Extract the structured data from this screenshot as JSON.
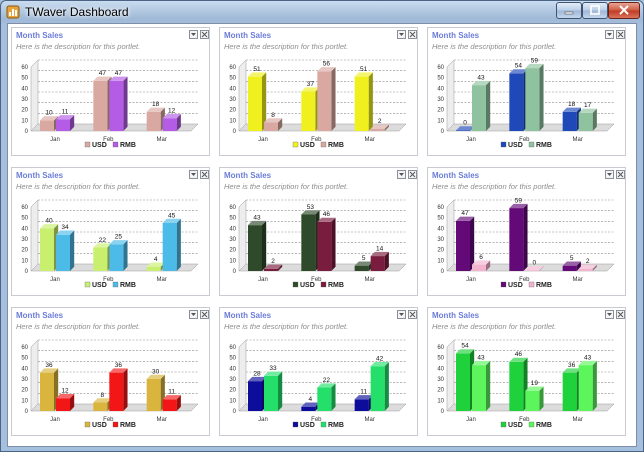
{
  "window": {
    "title": "TWaver Dashboard"
  },
  "portlets": [
    {
      "title": "Month Sales",
      "description": "Here is the description for this portlet.",
      "chart_data": {
        "type": "bar",
        "categories": [
          "Jan",
          "Feb",
          "Mar"
        ],
        "ylim": [
          0,
          60
        ],
        "yticks": [
          0,
          10,
          20,
          30,
          40,
          50,
          60
        ],
        "series": [
          {
            "name": "USD",
            "color": "#d9a9a1",
            "values": [
              10,
              47,
              18
            ]
          },
          {
            "name": "RMB",
            "color": "#b45ce6",
            "values": [
              11,
              47,
              12
            ]
          }
        ]
      }
    },
    {
      "title": "Month Sales",
      "description": "Here is the description for this portlet.",
      "chart_data": {
        "type": "bar",
        "categories": [
          "Jan",
          "Feb",
          "Mar"
        ],
        "ylim": [
          0,
          60
        ],
        "yticks": [
          0,
          10,
          20,
          30,
          40,
          50,
          60
        ],
        "series": [
          {
            "name": "USD",
            "color": "#f0f01e",
            "values": [
              51,
              37,
              51
            ]
          },
          {
            "name": "RMB",
            "color": "#d9a9a1",
            "values": [
              8,
              56,
              2
            ]
          }
        ]
      }
    },
    {
      "title": "Month Sales",
      "description": "Here is the description for this portlet.",
      "chart_data": {
        "type": "bar",
        "categories": [
          "Jan",
          "Feb",
          "Mar"
        ],
        "ylim": [
          0,
          60
        ],
        "yticks": [
          0,
          10,
          20,
          30,
          40,
          50,
          60
        ],
        "series": [
          {
            "name": "USD",
            "color": "#1f49b8",
            "values": [
              0,
              54,
              18
            ]
          },
          {
            "name": "RMB",
            "color": "#8fc3a0",
            "values": [
              43,
              59,
              17
            ]
          }
        ]
      }
    },
    {
      "title": "Month Sales",
      "description": "Here is the description for this portlet.",
      "chart_data": {
        "type": "bar",
        "categories": [
          "Jan",
          "Feb",
          "Mar"
        ],
        "ylim": [
          0,
          60
        ],
        "yticks": [
          0,
          10,
          20,
          30,
          40,
          50,
          60
        ],
        "series": [
          {
            "name": "USD",
            "color": "#c8ef6d",
            "values": [
              40,
              22,
              4
            ]
          },
          {
            "name": "RMB",
            "color": "#4dbbe8",
            "values": [
              34,
              25,
              45
            ]
          }
        ]
      }
    },
    {
      "title": "Month Sales",
      "description": "Here is the description for this portlet.",
      "chart_data": {
        "type": "bar",
        "categories": [
          "Jan",
          "Feb",
          "Mar"
        ],
        "ylim": [
          0,
          60
        ],
        "yticks": [
          0,
          10,
          20,
          30,
          40,
          50,
          60
        ],
        "series": [
          {
            "name": "USD",
            "color": "#2f4a2a",
            "values": [
              43,
              53,
              5
            ]
          },
          {
            "name": "RMB",
            "color": "#7a1c3d",
            "values": [
              2,
              46,
              14
            ]
          }
        ]
      }
    },
    {
      "title": "Month Sales",
      "description": "Here is the description for this portlet.",
      "chart_data": {
        "type": "bar",
        "categories": [
          "Jan",
          "Feb",
          "Mar"
        ],
        "ylim": [
          0,
          60
        ],
        "yticks": [
          0,
          10,
          20,
          30,
          40,
          50,
          60
        ],
        "series": [
          {
            "name": "USD",
            "color": "#630a78",
            "values": [
              47,
              59,
              5
            ]
          },
          {
            "name": "RMB",
            "color": "#f3b3cf",
            "values": [
              6,
              0,
              2
            ]
          }
        ]
      }
    },
    {
      "title": "Month Sales",
      "description": "Here is the description for this portlet.",
      "chart_data": {
        "type": "bar",
        "categories": [
          "Jan",
          "Feb",
          "Mar"
        ],
        "ylim": [
          0,
          60
        ],
        "yticks": [
          0,
          10,
          20,
          30,
          40,
          50,
          60
        ],
        "series": [
          {
            "name": "USD",
            "color": "#d9b53d",
            "values": [
              36,
              8,
              30
            ]
          },
          {
            "name": "RMB",
            "color": "#f21616",
            "values": [
              12,
              36,
              11
            ]
          }
        ]
      }
    },
    {
      "title": "Month Sales",
      "description": "Here is the description for this portlet.",
      "chart_data": {
        "type": "bar",
        "categories": [
          "Jan",
          "Feb",
          "Mar"
        ],
        "ylim": [
          0,
          60
        ],
        "yticks": [
          0,
          10,
          20,
          30,
          40,
          50,
          60
        ],
        "series": [
          {
            "name": "USD",
            "color": "#0d0d9c",
            "values": [
              28,
              4,
              11
            ]
          },
          {
            "name": "RMB",
            "color": "#24e06a",
            "values": [
              33,
              22,
              42
            ]
          }
        ]
      }
    },
    {
      "title": "Month Sales",
      "description": "Here is the description for this portlet.",
      "chart_data": {
        "type": "bar",
        "categories": [
          "Jan",
          "Feb",
          "Mar"
        ],
        "ylim": [
          0,
          60
        ],
        "yticks": [
          0,
          10,
          20,
          30,
          40,
          50,
          60
        ],
        "series": [
          {
            "name": "USD",
            "color": "#1fd13a",
            "values": [
              54,
              46,
              36
            ]
          },
          {
            "name": "RMB",
            "color": "#5cf55c",
            "values": [
              43,
              19,
              43
            ]
          }
        ]
      }
    }
  ]
}
